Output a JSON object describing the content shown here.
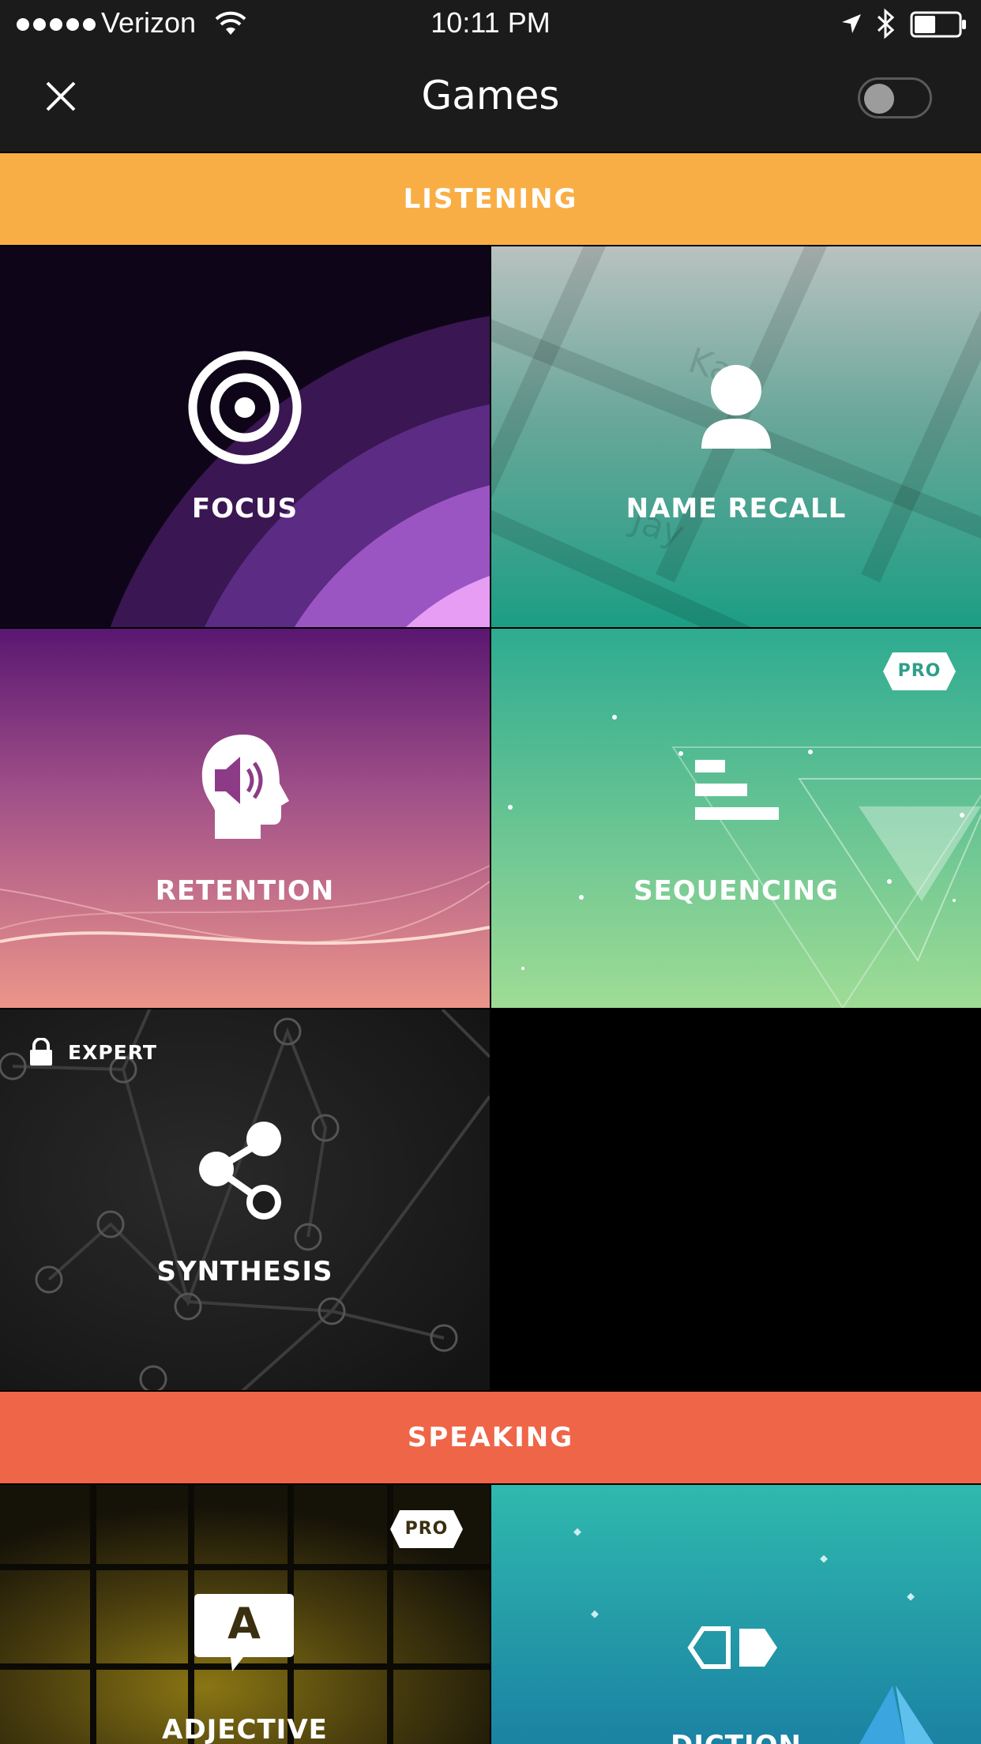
{
  "status_bar": {
    "carrier": "Verizon",
    "time": "10:11 PM"
  },
  "nav": {
    "title": "Games",
    "close_icon": "close-icon",
    "toggle_state": "off"
  },
  "sections": {
    "listening": {
      "label": "LISTENING",
      "color": "#F9AE45"
    },
    "speaking": {
      "label": "SPEAKING",
      "color": "#EF6547"
    }
  },
  "tiles": {
    "focus": {
      "label": "FOCUS",
      "icon": "target-icon"
    },
    "name_recall": {
      "label": "NAME RECALL",
      "icon": "person-icon",
      "bg_text_1": "Ka",
      "bg_text_2": "Jay"
    },
    "retention": {
      "label": "RETENTION",
      "icon": "head-speaker-icon"
    },
    "sequencing": {
      "label": "SEQUENCING",
      "icon": "sequence-bars-icon",
      "badge": "PRO"
    },
    "synthesis": {
      "label": "SYNTHESIS",
      "icon": "share-nodes-icon",
      "lock_label": "EXPERT"
    },
    "adjective": {
      "label": "ADJECTIVE",
      "icon": "speech-bubble-a-icon",
      "badge": "PRO",
      "bubble_letter": "A"
    },
    "diction": {
      "label": "DICTION",
      "icon": "tags-icon"
    }
  }
}
